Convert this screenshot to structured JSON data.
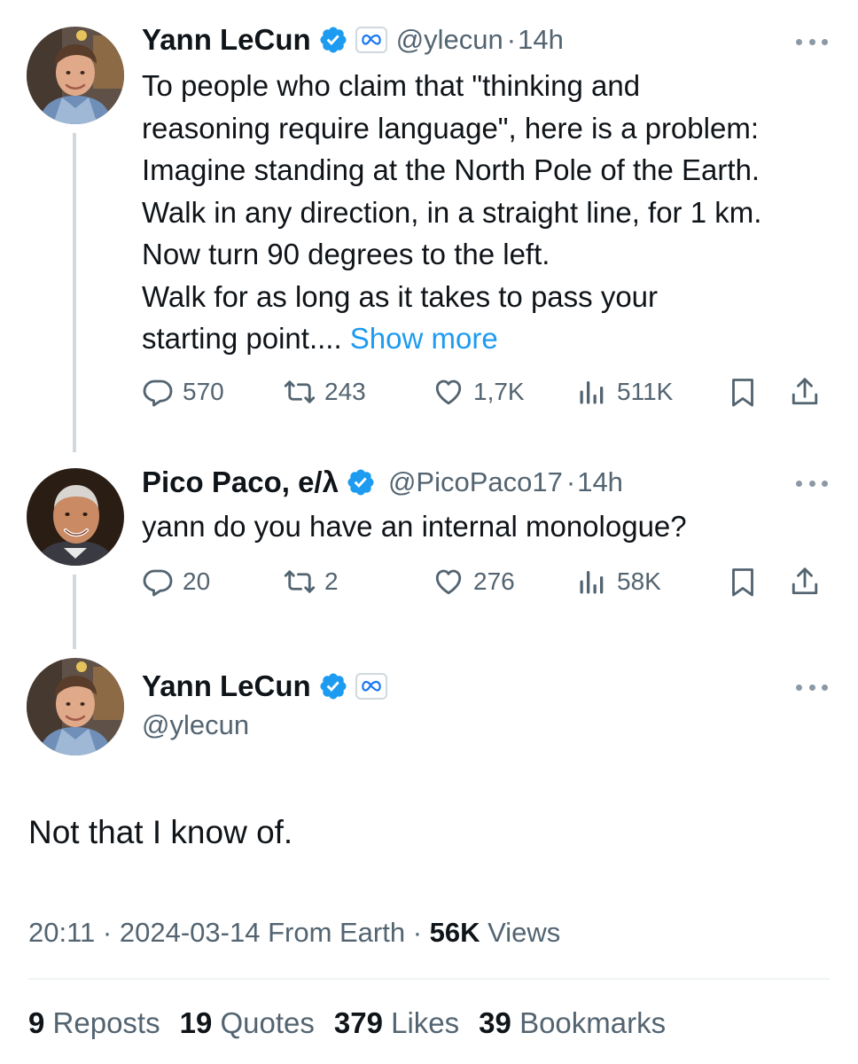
{
  "colors": {
    "link": "#1d9bf0",
    "muted": "#536471",
    "text": "#0f1419",
    "verified": "#1d9bf0",
    "thread_line": "#cfd9de"
  },
  "tweets": [
    {
      "name": "Yann LeCun",
      "handle": "@ylecun",
      "time": "14h",
      "verified_icon": "verified-badge-icon",
      "affiliation_icon": "meta-logo-icon",
      "text_lines": [
        "To people who claim that \"thinking and",
        "reasoning require language\", here is a problem:",
        "Imagine standing at the North Pole of the Earth.",
        "Walk in any direction, in a straight line, for 1 km.",
        "Now turn 90 degrees to the left.",
        "Walk for as long as it takes to pass your",
        "starting point...."
      ],
      "show_more": "Show more",
      "replies": "570",
      "reposts": "243",
      "likes": "1,7K",
      "views": "511K"
    },
    {
      "name": "Pico Paco, e/λ",
      "handle": "@PicoPaco17",
      "time": "14h",
      "verified_icon": "verified-badge-icon",
      "text": "yann do you have an internal monologue?",
      "replies": "20",
      "reposts": "2",
      "likes": "276",
      "views": "58K"
    }
  ],
  "main_tweet": {
    "name": "Yann LeCun",
    "handle": "@ylecun",
    "verified_icon": "verified-badge-icon",
    "affiliation_icon": "meta-logo-icon",
    "text": "Not that I know of.",
    "time": "20:11",
    "date": "2024-03-14",
    "source": "From Earth",
    "views_count": "56K",
    "views_label": "Views",
    "separator": "·",
    "stats": {
      "reposts_count": "9",
      "reposts_label": "Reposts",
      "quotes_count": "19",
      "quotes_label": "Quotes",
      "likes_count": "379",
      "likes_label": "Likes",
      "bookmarks_count": "39",
      "bookmarks_label": "Bookmarks"
    }
  }
}
